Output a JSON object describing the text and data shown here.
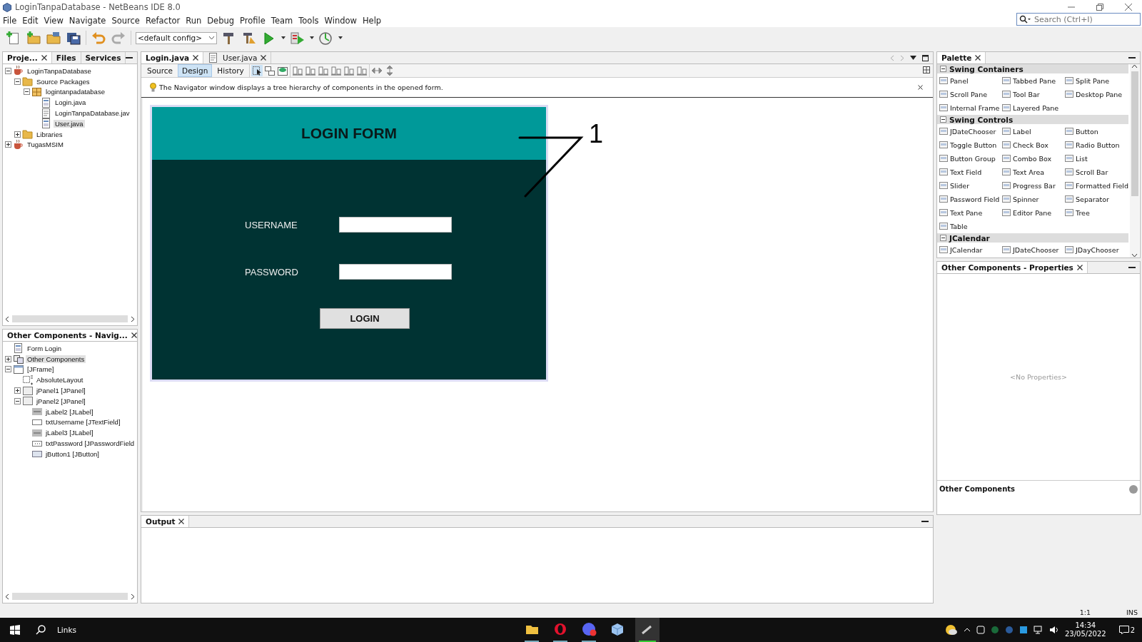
{
  "window": {
    "title": "LoginTanpaDatabase - NetBeans IDE 8.0"
  },
  "menu": [
    "File",
    "Edit",
    "View",
    "Navigate",
    "Source",
    "Refactor",
    "Run",
    "Debug",
    "Profile",
    "Team",
    "Tools",
    "Window",
    "Help"
  ],
  "toolbar": {
    "config": "<default config>"
  },
  "search": {
    "placeholder": "Search (Ctrl+I)"
  },
  "projects": {
    "tabs": [
      {
        "label": "Proje...",
        "selected": true
      },
      {
        "label": "Files",
        "selected": false
      },
      {
        "label": "Services",
        "selected": false
      }
    ],
    "tree": [
      {
        "label": "LoginTanpaDatabase",
        "kind": "project",
        "expanded": true,
        "selected": false,
        "children": [
          {
            "label": "Source Packages",
            "kind": "folder",
            "expanded": true,
            "selected": false,
            "children": [
              {
                "label": "logintanpadatabase",
                "kind": "package",
                "expanded": true,
                "selected": false,
                "children": [
                  {
                    "label": "Login.java",
                    "kind": "form",
                    "selected": false
                  },
                  {
                    "label": "LoginTanpaDatabase.jav",
                    "kind": "file",
                    "selected": false
                  },
                  {
                    "label": "User.java",
                    "kind": "form",
                    "selected": true
                  }
                ]
              }
            ]
          },
          {
            "label": "Libraries",
            "kind": "folder",
            "expanded": false,
            "selected": false
          }
        ]
      },
      {
        "label": "TugasMSIM",
        "kind": "project",
        "expanded": false,
        "selected": false
      }
    ]
  },
  "navigator": {
    "title": "Other Components - Navig...",
    "tree": [
      {
        "label": "Form Login",
        "kind": "form",
        "selected": false
      },
      {
        "label": "Other Components",
        "kind": "group",
        "expanded": false,
        "selected": true
      },
      {
        "label": "[JFrame]",
        "kind": "frame",
        "expanded": true,
        "selected": false,
        "children": [
          {
            "label": "AbsoluteLayout",
            "kind": "layout",
            "selected": false
          },
          {
            "label": "jPanel1 [JPanel]",
            "kind": "panel",
            "expanded": false,
            "selected": false
          },
          {
            "label": "jPanel2 [JPanel]",
            "kind": "panel",
            "expanded": true,
            "selected": false,
            "children": [
              {
                "label": "jLabel2 [JLabel]",
                "kind": "label",
                "selected": false
              },
              {
                "label": "txtUsername [JTextField]",
                "kind": "textfield",
                "selected": false
              },
              {
                "label": "jLabel3 [JLabel]",
                "kind": "label",
                "selected": false
              },
              {
                "label": "txtPassword [JPasswordField",
                "kind": "password",
                "selected": false
              },
              {
                "label": "jButton1 [JButton]",
                "kind": "button",
                "selected": false
              }
            ]
          }
        ]
      }
    ]
  },
  "editor": {
    "tabs": [
      {
        "label": "Login.java",
        "selected": true
      },
      {
        "label": "User.java",
        "selected": false
      }
    ],
    "views": [
      {
        "label": "Source",
        "selected": false
      },
      {
        "label": "Design",
        "selected": true
      },
      {
        "label": "History",
        "selected": false
      }
    ],
    "hint": "The Navigator window displays a tree hierarchy of components in the opened form.",
    "form": {
      "title": "LOGIN FORM",
      "fields": [
        {
          "label": "USERNAME"
        },
        {
          "label": "PASSWORD"
        }
      ],
      "button": "LOGIN"
    },
    "annotation": "1"
  },
  "palette": {
    "title": "Palette",
    "categories": [
      {
        "name": "Swing Containers",
        "expanded": true,
        "items": [
          "Panel",
          "Tabbed Pane",
          "Split Pane",
          "Scroll Pane",
          "Tool Bar",
          "Desktop Pane",
          "Internal Frame",
          "Layered Pane"
        ]
      },
      {
        "name": "Swing Controls",
        "expanded": true,
        "items": [
          "JDateChooser",
          "Label",
          "Button",
          "Toggle Button",
          "Check Box",
          "Radio Button",
          "Button Group",
          "Combo Box",
          "List",
          "Text Field",
          "Text Area",
          "Scroll Bar",
          "Slider",
          "Progress Bar",
          "Formatted Field",
          "Password Field",
          "Spinner",
          "Separator",
          "Text Pane",
          "Editor Pane",
          "Tree",
          "Table"
        ]
      },
      {
        "name": "JCalendar",
        "expanded": true,
        "items": [
          "JCalendar",
          "JDateChooser",
          "JDayChooser"
        ]
      }
    ]
  },
  "properties": {
    "title": "Other Components - Properties",
    "empty": "<No Properties>",
    "footer": "Other Components"
  },
  "output": {
    "title": "Output"
  },
  "status_bar": {
    "position": "1:1",
    "mode": "INS"
  },
  "taskbar": {
    "search": "Links",
    "time": "14:34",
    "date": "23/05/2022",
    "notifications": "2"
  }
}
